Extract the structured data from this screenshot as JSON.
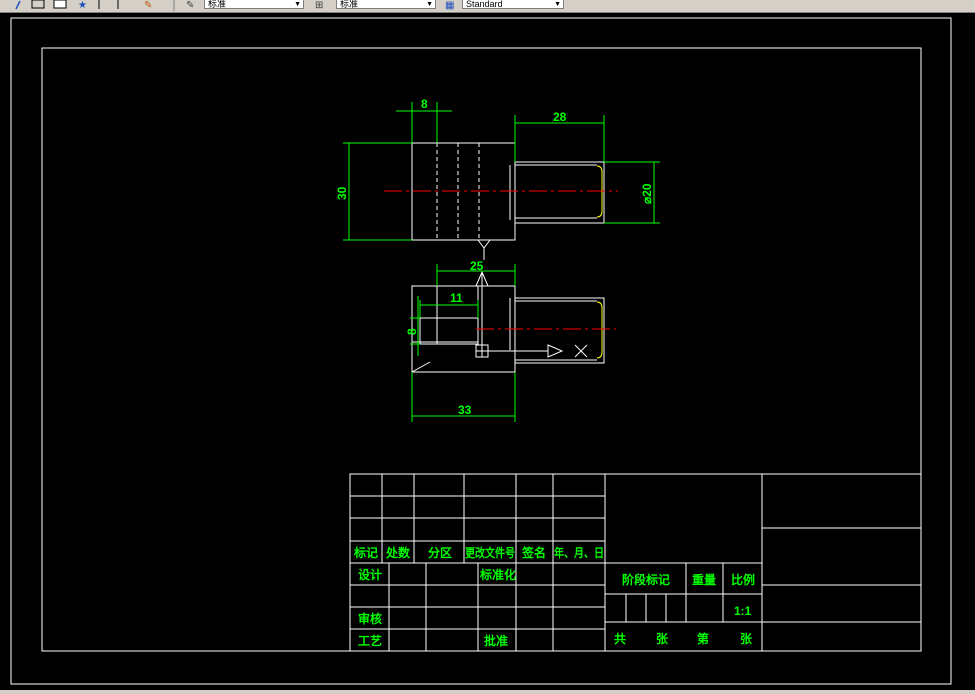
{
  "toolbar": {
    "combo_1": "标准",
    "combo_2": "标准",
    "combo_3": "Standard"
  },
  "colors": {
    "background": "#000000",
    "linework": "#ffffff",
    "dimension": "#00ff00",
    "centerline": "#ff0000",
    "hidden_line": "#ffff00"
  },
  "dimensions": {
    "d8_top": "8",
    "d28": "28",
    "d30": "30",
    "d20": "⌀20",
    "d25": "25",
    "d11": "11",
    "d8_left": "8",
    "d33": "33"
  },
  "title_block": {
    "biaoji": "标记",
    "chushu": "处数",
    "fenqu": "分区",
    "genggai": "更改文件号",
    "qianming": "签名",
    "nianyueri": "年、月、日",
    "sheji": "设计",
    "biaozhunhua": "标准化",
    "shenhe": "审核",
    "gongyi": "工艺",
    "pizhun": "批准",
    "jieduan": "阶段标记",
    "zhongliang": "重量",
    "bili": "比例",
    "bili_value": "1:1",
    "gong": "共",
    "zhang1": "张",
    "di": "第",
    "zhang2": "张"
  }
}
